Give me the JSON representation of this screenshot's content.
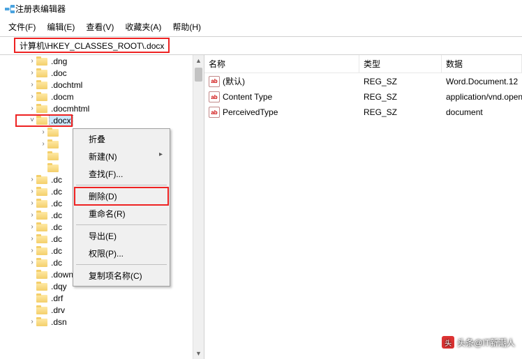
{
  "title": "注册表编辑器",
  "menus": [
    "文件(F)",
    "编辑(E)",
    "查看(V)",
    "收藏夹(A)",
    "帮助(H)"
  ],
  "address": "计算机\\HKEY_CLASSES_ROOT\\.docx",
  "tree": {
    "items": [
      {
        "indent": 40,
        "exp": ">",
        "label": ".dng"
      },
      {
        "indent": 40,
        "exp": ">",
        "label": ".doc"
      },
      {
        "indent": 40,
        "exp": ">",
        "label": ".dochtml"
      },
      {
        "indent": 40,
        "exp": ">",
        "label": ".docm"
      },
      {
        "indent": 40,
        "exp": ">",
        "label": ".docmhtml"
      },
      {
        "indent": 40,
        "exp": "v",
        "label": ".docx",
        "selected": true
      },
      {
        "indent": 56,
        "exp": ">",
        "label": ""
      },
      {
        "indent": 56,
        "exp": ">",
        "label": ""
      },
      {
        "indent": 56,
        "exp": "",
        "label": ""
      },
      {
        "indent": 56,
        "exp": "",
        "label": ""
      },
      {
        "indent": 40,
        "exp": ">",
        "label": ".dc"
      },
      {
        "indent": 40,
        "exp": ">",
        "label": ".dc"
      },
      {
        "indent": 40,
        "exp": ">",
        "label": ".dc"
      },
      {
        "indent": 40,
        "exp": ">",
        "label": ".dc"
      },
      {
        "indent": 40,
        "exp": ">",
        "label": ".dc"
      },
      {
        "indent": 40,
        "exp": ">",
        "label": ".dc"
      },
      {
        "indent": 40,
        "exp": ">",
        "label": ".dc"
      },
      {
        "indent": 40,
        "exp": ">",
        "label": ".dc"
      },
      {
        "indent": 40,
        "exp": "",
        "label": ".downlist"
      },
      {
        "indent": 40,
        "exp": "",
        "label": ".dqy"
      },
      {
        "indent": 40,
        "exp": "",
        "label": ".drf"
      },
      {
        "indent": 40,
        "exp": "",
        "label": ".drv"
      },
      {
        "indent": 40,
        "exp": ">",
        "label": ".dsn"
      }
    ]
  },
  "list": {
    "headers": {
      "name": "名称",
      "type": "类型",
      "data": "数据"
    },
    "rows": [
      {
        "name": "(默认)",
        "type": "REG_SZ",
        "data": "Word.Document.12"
      },
      {
        "name": "Content Type",
        "type": "REG_SZ",
        "data": "application/vnd.openxmlfo"
      },
      {
        "name": "PerceivedType",
        "type": "REG_SZ",
        "data": "document"
      }
    ]
  },
  "context_menu": {
    "items": [
      {
        "label": "折叠"
      },
      {
        "label": "新建(N)",
        "arrow": true
      },
      {
        "label": "查找(F)..."
      },
      {
        "sep": true
      },
      {
        "label": "删除(D)",
        "highlight": true
      },
      {
        "label": "重命名(R)"
      },
      {
        "sep": true
      },
      {
        "label": "导出(E)"
      },
      {
        "label": "权限(P)..."
      },
      {
        "sep": true
      },
      {
        "label": "复制项名称(C)"
      }
    ]
  },
  "watermark": "头条@IT新潮人"
}
